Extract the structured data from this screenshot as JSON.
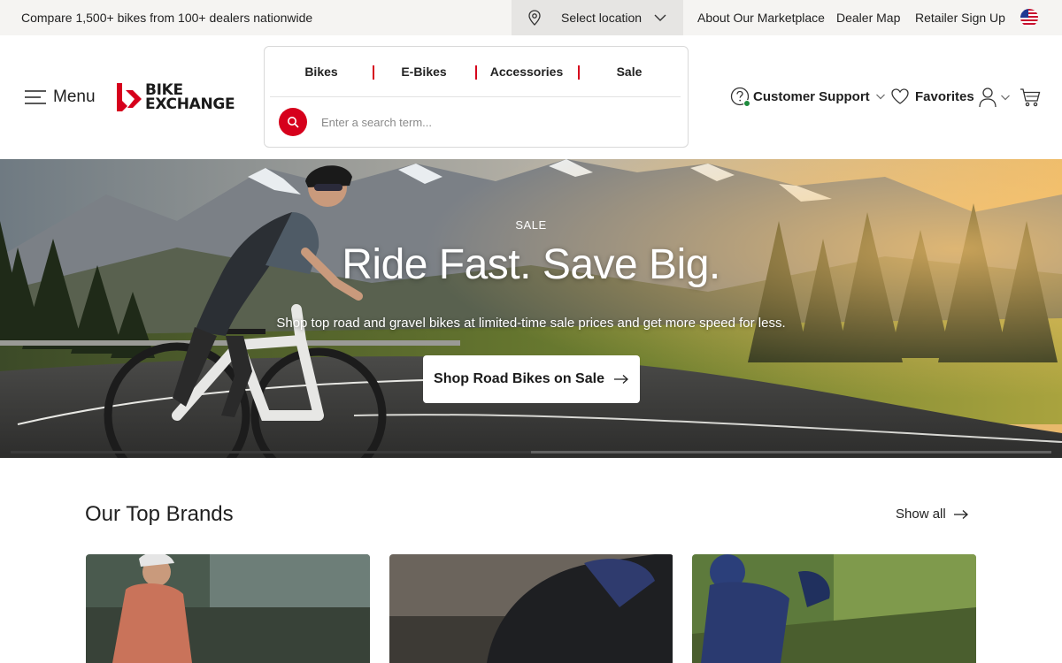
{
  "topbar": {
    "tagline": "Compare 1,500+ bikes from 100+ dealers nationwide",
    "location_label": "Select location",
    "links": [
      "About Our Marketplace",
      "Dealer Map",
      "Retailer Sign Up"
    ],
    "flag_icon": "us-flag-icon"
  },
  "header": {
    "menu_label": "Menu",
    "logo_line1": "BIKE",
    "logo_line2": "EXCHANGE",
    "categories": [
      "Bikes",
      "E-Bikes",
      "Accessories",
      "Sale"
    ],
    "search_placeholder": "Enter a search term...",
    "support_label": "Customer Support",
    "favorites_label": "Favorites"
  },
  "hero": {
    "eyebrow": "SALE",
    "headline": "Ride Fast. Save Big.",
    "subtitle": "Shop top road and gravel bikes at limited-time sale prices and get more speed for less.",
    "cta_label": "Shop Road Bikes on Sale",
    "carousel_progress": 0.5
  },
  "brands": {
    "title": "Our Top Brands",
    "show_all_label": "Show all"
  },
  "colors": {
    "accent": "#d6001c",
    "topbar_bg": "#f5f4f2",
    "location_bg": "#e6e5e3",
    "online_dot": "#1e8a3c"
  }
}
